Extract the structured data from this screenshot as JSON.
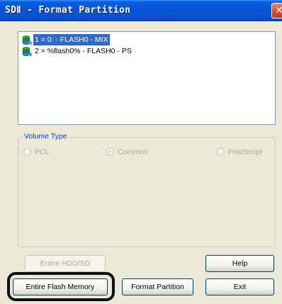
{
  "window": {
    "title": "SDⅡ - Format Partition",
    "close_glyph": "✕"
  },
  "partitions": [
    {
      "label": "1 = 0: - FLASH0 - MIX",
      "icon": "drive-icon",
      "selected": true
    },
    {
      "label": "2 = %flash0% - FLASH0 - PS",
      "icon": "drive-icon",
      "selected": false
    }
  ],
  "volume_type": {
    "label": "Volume Type",
    "options": [
      {
        "label": "PCL",
        "selected": false,
        "enabled": false
      },
      {
        "label": "Common",
        "selected": true,
        "enabled": false
      },
      {
        "label": "PostScript",
        "selected": false,
        "enabled": false
      }
    ]
  },
  "buttons": {
    "entire_hdd": "Entire HDD/SD",
    "help": "Help",
    "entire_flash": "Entire Flash Memory",
    "format_partition": "Format Partition",
    "exit": "Exit"
  },
  "colors": {
    "titlebar": "#0854d8",
    "selection": "#316ac5",
    "group_label": "#0046d5",
    "dialog_bg": "#ece9d8"
  }
}
